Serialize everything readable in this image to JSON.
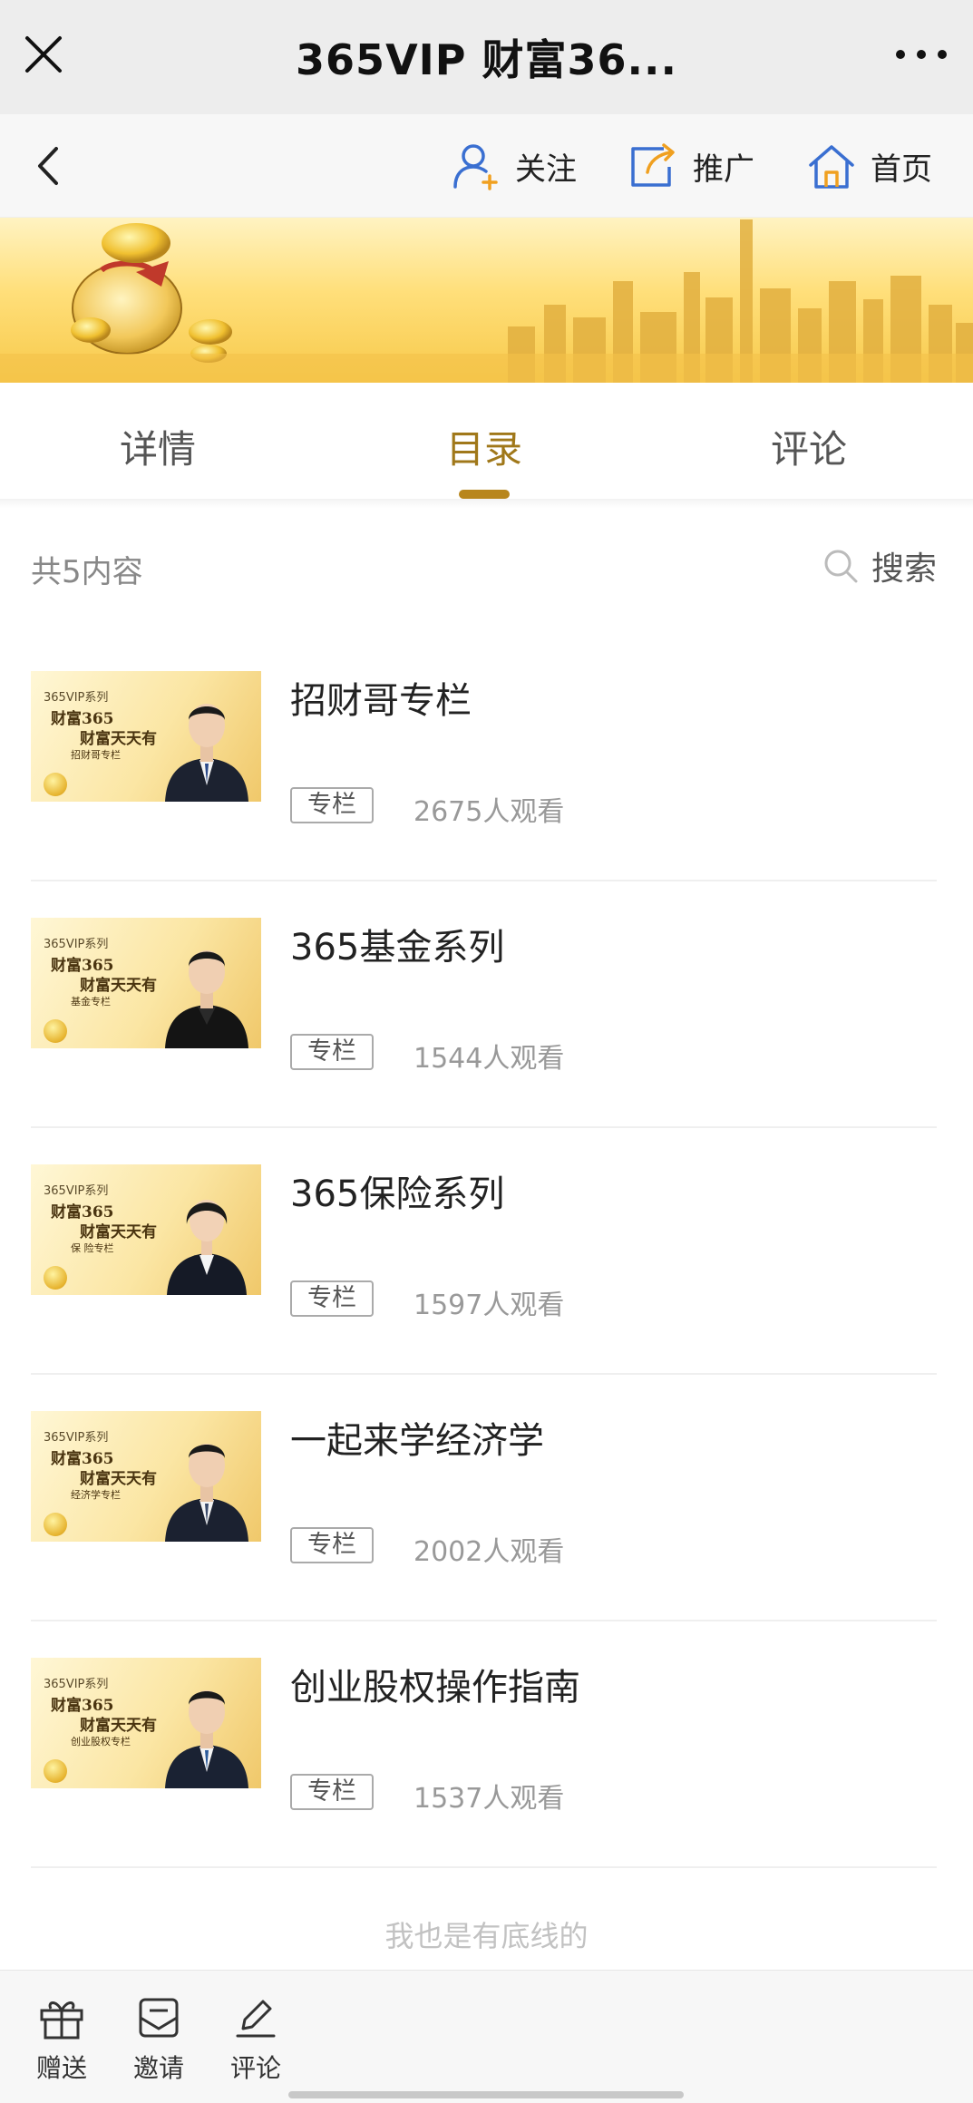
{
  "titlebar": {
    "title": "365VIP 财富36..."
  },
  "navbar": {
    "follow": "关注",
    "promote": "推广",
    "home": "首页"
  },
  "tabs": {
    "detail": "详情",
    "catalog": "目录",
    "comment": "评论",
    "active": "目录"
  },
  "list_header": {
    "count": "共5内容",
    "search": "搜索"
  },
  "items": [
    {
      "title": "招财哥专栏",
      "tag": "专栏",
      "views": "2675人观看"
    },
    {
      "title": "365基金系列",
      "tag": "专栏",
      "views": "1544人观看"
    },
    {
      "title": "365保险系列",
      "tag": "专栏",
      "views": "1597人观看"
    },
    {
      "title": "一起来学经济学",
      "tag": "专栏",
      "views": "2002人观看"
    },
    {
      "title": "创业股权操作指南",
      "tag": "专栏",
      "views": "1537人观看"
    }
  ],
  "thumbs": [
    {
      "series": "365VIP系列",
      "line1": "财富365",
      "line2": "财富天天有",
      "sub": "招财哥专栏"
    },
    {
      "series": "365VIP系列",
      "line1": "财富365",
      "line2": "财富天天有",
      "sub": "基金专栏"
    },
    {
      "series": "365VIP系列",
      "line1": "财富365",
      "line2": "财富天天有",
      "sub": "保 险专栏"
    },
    {
      "series": "365VIP系列",
      "line1": "财富365",
      "line2": "财富天天有",
      "sub": "经济学专栏"
    },
    {
      "series": "365VIP系列",
      "line1": "财富365",
      "line2": "财富天天有",
      "sub": "创业股权专栏"
    }
  ],
  "footer_text": "我也是有底线的",
  "bottombar": {
    "gift": "赠送",
    "invite": "邀请",
    "comment": "评论"
  },
  "colors": {
    "accent": "#b8861c",
    "active_tab": "#a0781a",
    "muted": "#999999"
  }
}
